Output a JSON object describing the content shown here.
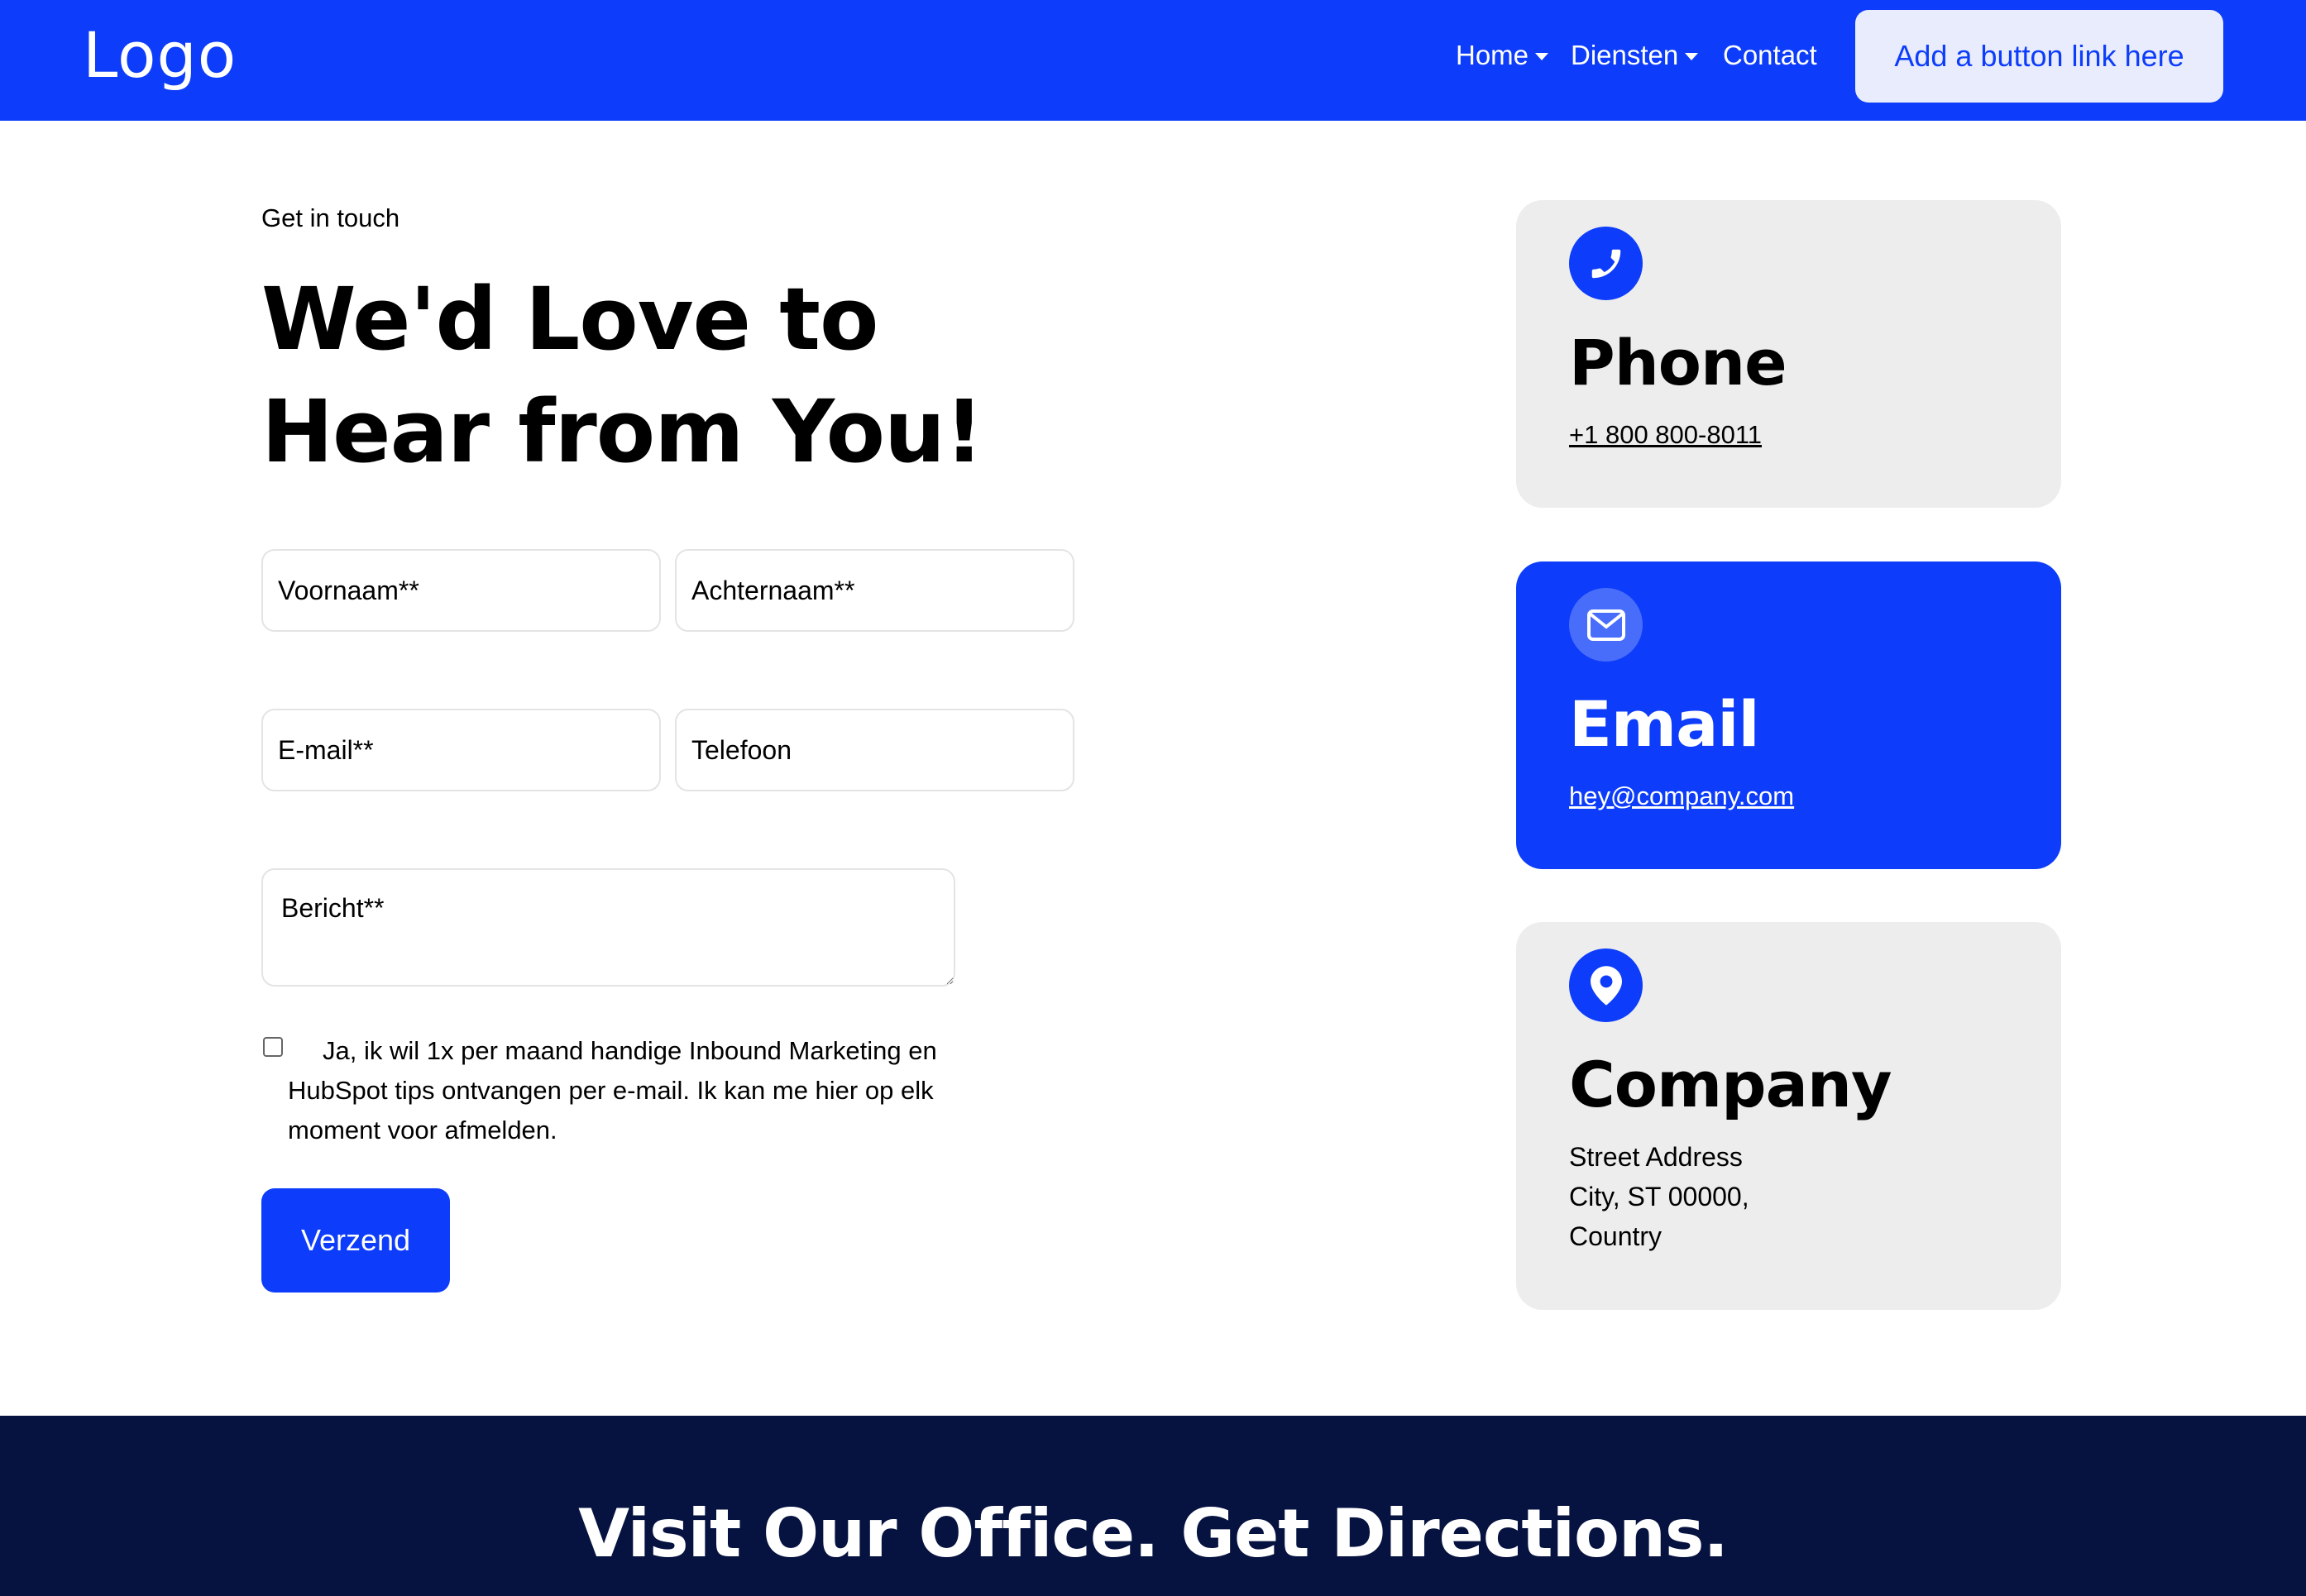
{
  "nav": {
    "logo": "Logo",
    "links": [
      {
        "label": "Home",
        "has_dropdown": true
      },
      {
        "label": "Diensten",
        "has_dropdown": true
      },
      {
        "label": "Contact",
        "has_dropdown": false
      }
    ],
    "cta_label": "Add a button link here"
  },
  "contact": {
    "eyebrow": "Get in touch",
    "heading": "We'd Love to Hear from You!",
    "form": {
      "first_name_placeholder": "Voornaam**",
      "last_name_placeholder": "Achternaam**",
      "email_placeholder": "E-mail**",
      "phone_placeholder": "Telefoon",
      "message_placeholder": "Bericht**",
      "consent_text": "Ja, ik wil 1x per maand handige Inbound Marketing en HubSpot tips ontvangen per e-mail. Ik kan me hier op elk moment voor afmelden.",
      "consent_checked": false,
      "submit_label": "Verzend"
    }
  },
  "cards": {
    "phone": {
      "icon": "phone-icon",
      "title": "Phone",
      "value": "+1 800 800-8011"
    },
    "email": {
      "icon": "envelope-icon",
      "title": "Email",
      "value": "hey@company.com"
    },
    "company": {
      "icon": "map-pin-icon",
      "title": "Company",
      "line1": "Street Address",
      "line2": "City, ST 00000,",
      "line3": "Country"
    }
  },
  "footer": {
    "title": "Visit Our Office. Get Directions."
  },
  "colors": {
    "brand_blue": "#0d3dfa",
    "card_grey": "#ededed",
    "footer_navy": "#06123f"
  }
}
